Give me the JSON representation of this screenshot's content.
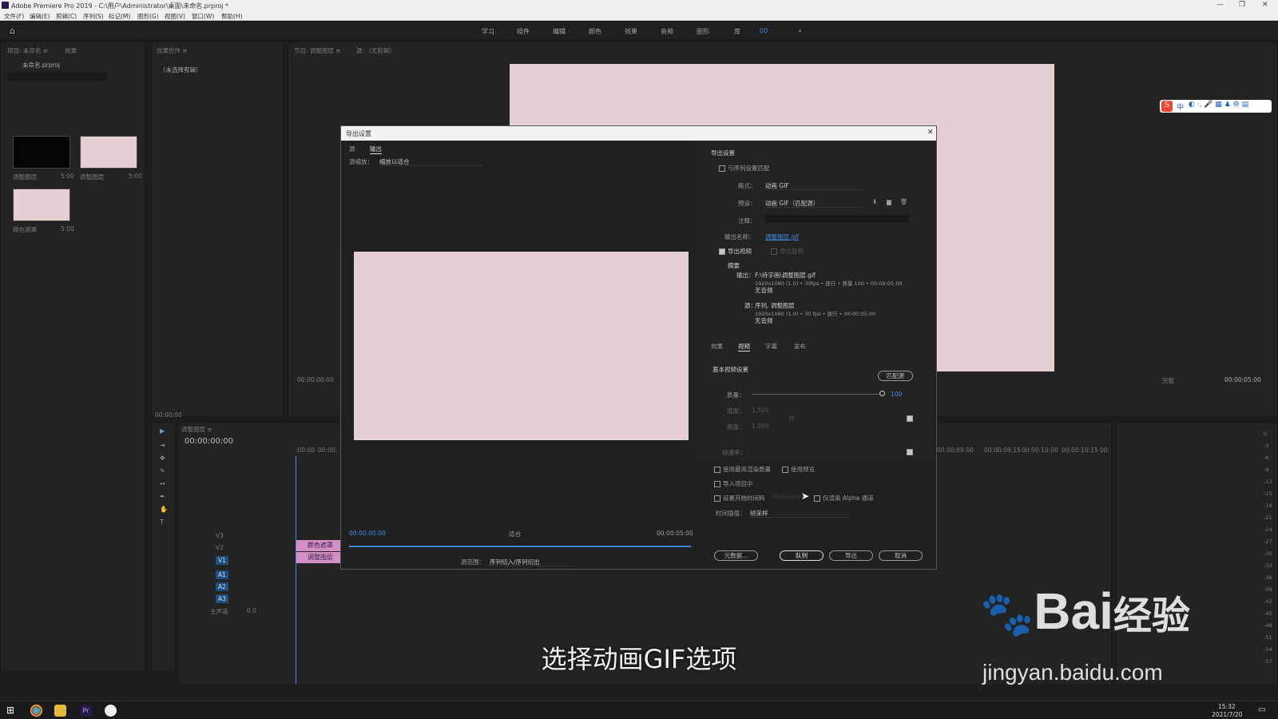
{
  "window": {
    "title": "Adobe Premiere Pro 2019 - C:\\用户\\Administrator\\桌面\\未命名.prproj *"
  },
  "menu": [
    "文件(F)",
    "编辑(E)",
    "剪辑(C)",
    "序列(S)",
    "标记(M)",
    "图形(G)",
    "视图(V)",
    "窗口(W)",
    "帮助(H)"
  ],
  "workspaces": [
    "学习",
    "组件",
    "编辑",
    "颜色",
    "效果",
    "音频",
    "图形",
    "库",
    "00",
    "»"
  ],
  "project": {
    "tab": "项目: 未命名 ≡",
    "tab2": "效果",
    "file": "未命名.prproj",
    "items": [
      {
        "name": "调整图层",
        "dur": "5:00"
      },
      {
        "name": "调整图层",
        "dur": "5:00"
      },
      {
        "name": "颜色遮罩",
        "dur": "5:00"
      }
    ]
  },
  "effect_controls": {
    "tab": "效果控件 ≡",
    "empty": "（未选择剪辑）",
    "time": "00:00:00"
  },
  "source": {
    "tab": "节目: 调整图层 ≡",
    "tab2": "源：（无剪辑）",
    "time": "00:00:00:00",
    "right_time": "00:00:05:00",
    "zoom": "完整"
  },
  "timeline": {
    "tab": "调整图层 ≡",
    "time": "00:00:00:00",
    "ruler_left": [
      ":00:00",
      "00:00:"
    ],
    "ruler_right": [
      "00:00:09:00",
      "00:00:09:15",
      "00:00:10:00",
      "00:00:10:15",
      "00:"
    ],
    "tracks": [
      "V3",
      "V2",
      "V1",
      "A1",
      "A2",
      "A3"
    ],
    "master": "主声道",
    "master_val": "0.0",
    "clips": [
      {
        "label": "颜色遮罩"
      },
      {
        "label": "调整图层"
      }
    ]
  },
  "meter_labels": [
    "0",
    "-3",
    "-6",
    "-9",
    "-12",
    "-15",
    "-18",
    "-21",
    "-24",
    "-27",
    "-30",
    "-33",
    "-36",
    "-39",
    "-42",
    "-45",
    "-48",
    "-51",
    "-54",
    "-57"
  ],
  "dialog": {
    "title": "导出设置",
    "close": "✕",
    "left_tabs": [
      "源",
      "输出"
    ],
    "scale_label": "源缩放：",
    "scale_value": "缩放以适合",
    "time_start": "00:00:00:00",
    "fit": "适合",
    "time_end": "00:00:05:00",
    "range_label": "源范围：",
    "range_value": "序列切入/序列切出",
    "export_settings": "导出设置",
    "match_seq": "与序列设置匹配",
    "format_label": "格式：",
    "format_value": "动画 GIF",
    "preset_label": "预设：",
    "preset_value": "动画 GIF（匹配源）",
    "comment_label": "注释：",
    "output_name_label": "输出名称：",
    "output_name": "调整图层.gif",
    "export_video": "导出视频",
    "export_audio": "导出音频",
    "summary_title": "摘要",
    "summary_output_label": "输出：",
    "summary_output_lines": [
      "F:\\待字画\\调整图层.gif",
      "1920x1080 (1.0) • 30fps • 逐行 • 质量 100 • 00:00:05:00",
      "无音频"
    ],
    "summary_source_label": "源：",
    "summary_source_lines": [
      "序列, 调整图层",
      "1920x1080 (1.0) • 30 fps • 逐行 • 00:00:05:00",
      "无音频"
    ],
    "sub_tabs": [
      "效果",
      "视频",
      "字幕",
      "发布"
    ],
    "basic_video": "基本视频设置",
    "match_source_btn": "匹配源",
    "quality_label": "质量：",
    "quality_value": "100",
    "width_label": "宽度：",
    "width_value": "1,920",
    "height_label": "高度：",
    "height_value": "1,080",
    "fps_label": "帧速率：",
    "max_render": "使用最高渲染质量",
    "use_preview": "使用预览",
    "import_project": "导入项目中",
    "set_timecode": "设置开始时间码",
    "timecode_val": "00:00:00:00",
    "alpha_only": "仅渲染 Alpha 通道",
    "interp_label": "时间插值：",
    "interp_value": "帧采样",
    "buttons": {
      "metadata": "元数据...",
      "queue": "队列",
      "export": "导出",
      "cancel": "取消"
    }
  },
  "subtitle": "选择动画GIF选项",
  "watermark": {
    "brand": "Bai",
    "brand2": "经验",
    "url": "jingyan.baidu.com"
  },
  "taskbar": {
    "time": "15:32",
    "date": "2021/7/20"
  },
  "ime": {
    "label": "中"
  }
}
